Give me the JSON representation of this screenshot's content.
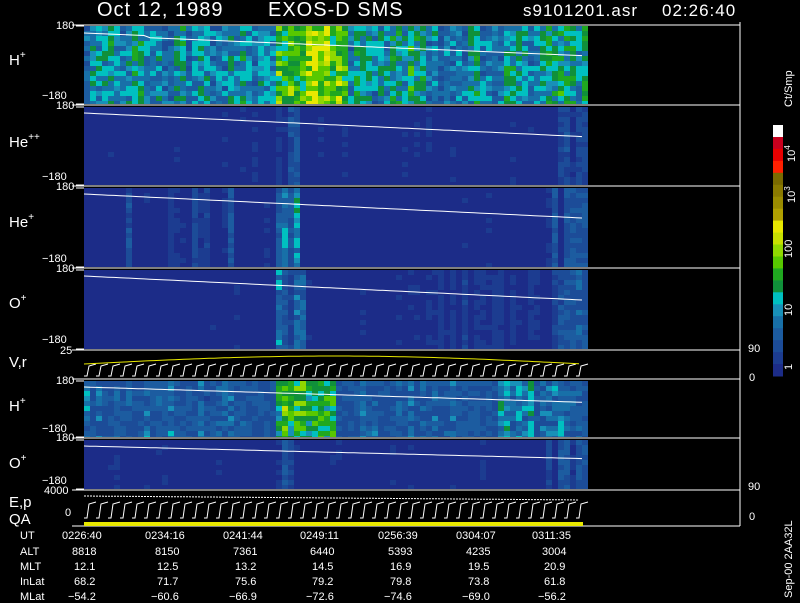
{
  "header": {
    "date": "Oct 12, 1989",
    "instrument": "EXOS-D SMS",
    "file": "s9101201.asr",
    "time": "02:26:40"
  },
  "panel_labels": {
    "h_plus_1": {
      "base": "H",
      "sup": "+"
    },
    "he_pp": {
      "base": "He",
      "sup": "++"
    },
    "he_plus": {
      "base": "He",
      "sup": "+"
    },
    "o_plus_1": {
      "base": "O",
      "sup": "+"
    },
    "vr": "V,r",
    "h_plus_2": {
      "base": "H",
      "sup": "+"
    },
    "o_plus_2": {
      "base": "O",
      "sup": "+"
    },
    "ep": "E,p",
    "qa": "QA"
  },
  "axis_ticks": {
    "top": "180",
    "bottom": "−180",
    "vr_top": "25",
    "vr_bottom": "0",
    "ep_top": "4000",
    "ep_bottom": "0",
    "vr_right_top": "90",
    "vr_right_bottom": "0",
    "ep_right_top": "90",
    "ep_right_bottom": "0"
  },
  "colorbar": {
    "title": "Ct/Smp",
    "labels": {
      "t4": "10",
      "t4sup": "4",
      "t3": "10",
      "t3sup": "3",
      "t2": "100",
      "t1": "10",
      "t0": "1"
    },
    "colors": [
      "#ffffff",
      "#c8001e",
      "#e80000",
      "#ff2000",
      "#7a6a00",
      "#8a7a00",
      "#9a8c00",
      "#b0a000",
      "#e8e800",
      "#c8e000",
      "#90d800",
      "#58c800",
      "#20a820",
      "#10903a",
      "#00c0c0",
      "#1890b8",
      "#1870a8",
      "#1c5ca0",
      "#1c4c98",
      "#1c3c90",
      "#1c2c88"
    ]
  },
  "footer": {
    "row_labels": [
      "UT",
      "ALT",
      "MLT",
      "InLat",
      "MLat"
    ],
    "columns": [
      [
        "0226:40",
        "8818",
        "12.1",
        "68.2",
        "−54.2"
      ],
      [
        "0234:16",
        "8150",
        "12.5",
        "71.7",
        "−60.6"
      ],
      [
        "0241:44",
        "7361",
        "13.2",
        "75.6",
        "−66.9"
      ],
      [
        "0249:11",
        "6440",
        "14.5",
        "79.2",
        "−72.6"
      ],
      [
        "0256:39",
        "5393",
        "16.9",
        "79.8",
        "−74.6"
      ],
      [
        "0304:07",
        "4235",
        "19.5",
        "73.8",
        "−69.0"
      ],
      [
        "0311:35",
        "3004",
        "20.9",
        "61.8",
        "−56.2"
      ]
    ],
    "stamp": "Sep-00 2AA32L"
  },
  "chart_data": {
    "type": "heatmap",
    "title": "Oct 12, 1989   EXOS-D SMS",
    "panels": [
      "H+",
      "He++",
      "He+",
      "O+",
      "V,r",
      "H+",
      "O+",
      "E,p",
      "QA"
    ],
    "x_tick_labels": [
      "0226:40",
      "0234:16",
      "0241:44",
      "0249:11",
      "0256:39",
      "0304:07",
      "0311:35"
    ],
    "angle_range": [
      -180,
      180
    ],
    "colorbar_unit": "Ct/Smp",
    "colorbar_ticks": [
      "1",
      "10",
      "100",
      "10^3",
      "10^4"
    ],
    "colorbar_scale": "log",
    "vr_range": [
      0,
      25
    ],
    "ep_range": [
      0,
      4000
    ],
    "right_axis_range": [
      0,
      90
    ]
  }
}
